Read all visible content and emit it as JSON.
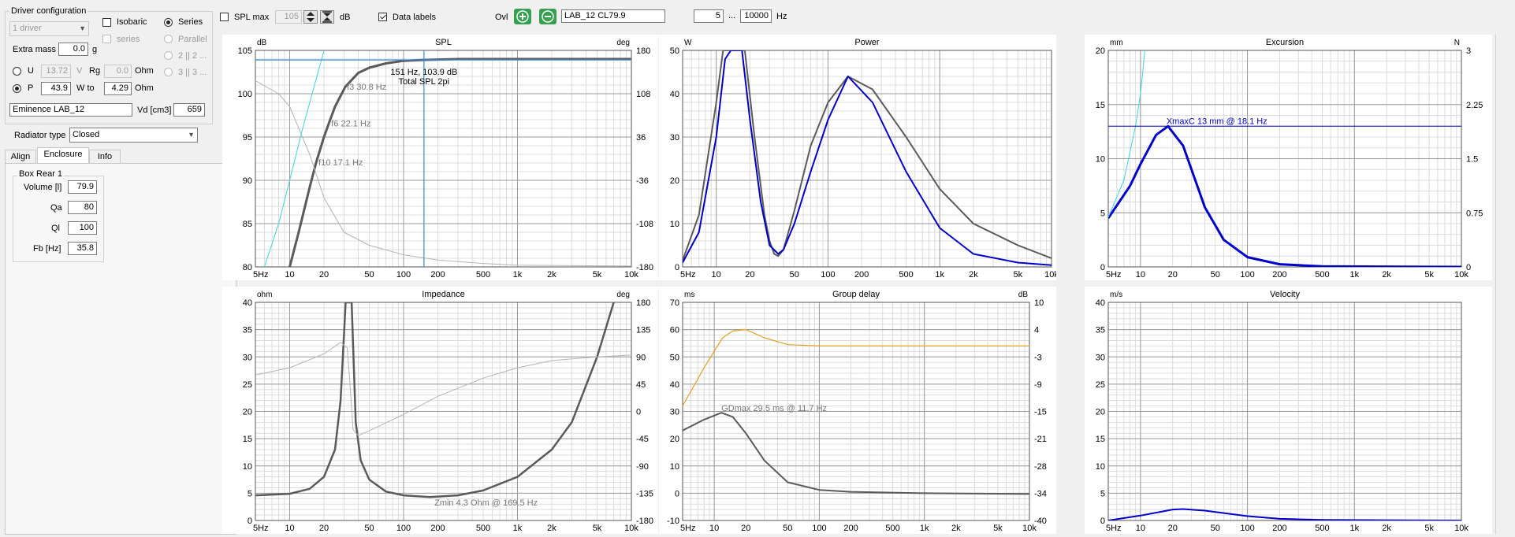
{
  "driver_config": {
    "legend": "Driver configuration",
    "drivers_select": "1 driver",
    "isobaric_label": "Isobaric",
    "series_label": "Series",
    "series_sub_label": "series",
    "parallel_label": "Parallel",
    "opt_2_label": "2 || 2 ...",
    "opt_3_label": "3 || 3 ...",
    "extra_mass_label": "Extra mass",
    "extra_mass_value": "0.0",
    "extra_mass_unit": "g",
    "u_label": "U",
    "u_value": "13.72",
    "u_unit": "V",
    "rg_label": "Rg",
    "rg_value": "0.0",
    "rg_unit": "Ohm",
    "p_label": "P",
    "p_value": "43.9",
    "w_to_label": "W to",
    "w_to_value": "4.29",
    "w_to_unit": "Ohm",
    "driver_name": "Eminence LAB_12",
    "vd_label": "Vd [cm3]",
    "vd_value": "659"
  },
  "radiator": {
    "label": "Radiator type",
    "value": "Closed"
  },
  "tabs": [
    "Align",
    "Enclosure",
    "Info"
  ],
  "box_rear": {
    "legend": "Box Rear 1",
    "fields": [
      {
        "label": "Volume [l]",
        "value": "79.9"
      },
      {
        "label": "Qa",
        "value": "80"
      },
      {
        "label": "Ql",
        "value": "100"
      },
      {
        "label": "Fb [Hz]",
        "value": "35.8"
      }
    ]
  },
  "toolbar": {
    "spl_max_label": "SPL max",
    "spl_max_value": "105",
    "db_unit": "dB",
    "data_labels": "Data labels",
    "ovl_label": "Ovl",
    "ovl_name": "LAB_12 CL79.9",
    "freq_from": "5",
    "freq_sep": "...",
    "freq_to": "10000",
    "freq_unit": "Hz"
  },
  "colors": {
    "main_curve": "#5a5a5a",
    "gray_curve": "#b4b4b4",
    "blue": "#0000cc",
    "cyan": "#38d8e0",
    "marker": "#3c8ad6",
    "orange": "#e8a020",
    "grid_major": "#9a9a9a",
    "grid_minor": "#dcdcdc",
    "ovl_button": "#34a050"
  },
  "freq_ticks": [
    "5Hz",
    "10",
    "20",
    "50",
    "100",
    "200",
    "500",
    "1k",
    "2k",
    "5k",
    "10k"
  ],
  "charts": {
    "spl": {
      "title": "SPL",
      "left_unit": "dB",
      "right_unit": "deg",
      "left_ticks": [
        "105",
        "100",
        "95",
        "90",
        "85",
        "80"
      ],
      "right_ticks": [
        "180",
        "108",
        "36",
        "-36",
        "-108",
        "-180"
      ],
      "annotations": [
        "151 Hz, 103.9 dB",
        "Total SPL 2pi",
        "f3 30.8 Hz",
        "f6 22.1 Hz",
        "f10 17.1 Hz"
      ]
    },
    "power": {
      "title": "Power",
      "left_unit": "W",
      "left_ticks": [
        "50",
        "40",
        "30",
        "20",
        "10",
        "0"
      ]
    },
    "excursion": {
      "title": "Excursion",
      "left_unit": "mm",
      "right_unit": "N",
      "left_ticks": [
        "20",
        "15",
        "10",
        "5",
        "0"
      ],
      "right_ticks": [
        "3",
        "2.25",
        "1.5",
        "0.75",
        "0"
      ],
      "annotations": [
        "XmaxC 13 mm  @ 18.1 Hz"
      ]
    },
    "impedance": {
      "title": "Impedance",
      "left_unit": "ohm",
      "right_unit": "deg",
      "left_ticks": [
        "40",
        "35",
        "30",
        "25",
        "20",
        "15",
        "10",
        "5",
        "0"
      ],
      "right_ticks": [
        "180",
        "135",
        "90",
        "45",
        "0",
        "-45",
        "-90",
        "-135",
        "-180"
      ],
      "annotations": [
        "Zmin 4.3 Ohm @ 169.5 Hz"
      ]
    },
    "group_delay": {
      "title": "Group delay",
      "left_unit": "ms",
      "right_unit": "dB",
      "left_ticks": [
        "70",
        "60",
        "50",
        "40",
        "30",
        "20",
        "10",
        "0",
        "-10"
      ],
      "right_ticks": [
        "10",
        "4",
        "-3",
        "-9",
        "-15",
        "-21",
        "-28",
        "-34",
        "-40"
      ],
      "annotations": [
        "GDmax 29.5 ms  @ 11.7 Hz"
      ]
    },
    "velocity": {
      "title": "Velocity",
      "left_unit": "m/s",
      "left_ticks": [
        "40",
        "35",
        "30",
        "25",
        "20",
        "15",
        "10",
        "5",
        "0"
      ]
    }
  },
  "chart_data": [
    {
      "type": "line",
      "title": "SPL",
      "x_scale": "log",
      "xlim": [
        5,
        10000
      ],
      "ylim": [
        80,
        105
      ],
      "y2lim": [
        -180,
        180
      ],
      "series": [
        {
          "values": [
            [
              8,
              76
            ],
            [
              10,
              80
            ],
            [
              12,
              84
            ],
            [
              15,
              89.2
            ],
            [
              17.1,
              92.1
            ],
            [
              20,
              95
            ],
            [
              22.1,
              96.6
            ],
            [
              25,
              98.5
            ],
            [
              30.8,
              100.8
            ],
            [
              40,
              102.4
            ],
            [
              50,
              103
            ],
            [
              70,
              103.5
            ],
            [
              100,
              103.8
            ],
            [
              151,
              103.9
            ],
            [
              300,
              104
            ],
            [
              1000,
              104
            ],
            [
              10000,
              104
            ]
          ]
        },
        {
          "values": [
            [
              5,
              101.5
            ],
            [
              8,
              100
            ],
            [
              10,
              98.5
            ],
            [
              15,
              93
            ],
            [
              20,
              88
            ],
            [
              30,
              84
            ],
            [
              50,
              82.5
            ],
            [
              100,
              81.4
            ],
            [
              200,
              80.8
            ],
            [
              500,
              80.4
            ],
            [
              1000,
              80.2
            ],
            [
              10000,
              80.1
            ]
          ]
        },
        {
          "values": [
            [
              6,
              80
            ],
            [
              8,
              85
            ],
            [
              10,
              90
            ],
            [
              13,
              96
            ],
            [
              20,
              105
            ]
          ]
        }
      ]
    },
    {
      "type": "line",
      "title": "Power",
      "x_scale": "log",
      "xlim": [
        5,
        10000
      ],
      "ylim": [
        0,
        50
      ],
      "series": [
        {
          "values": [
            [
              5,
              1.5
            ],
            [
              7,
              12
            ],
            [
              10,
              38
            ],
            [
              11.5,
              50
            ],
            [
              18,
              50
            ],
            [
              22,
              30
            ],
            [
              27,
              12
            ],
            [
              30,
              6
            ],
            [
              33,
              3
            ],
            [
              35.8,
              2.5
            ],
            [
              40,
              4
            ],
            [
              50,
              13
            ],
            [
              70,
              28
            ],
            [
              100,
              38
            ],
            [
              151,
              44
            ],
            [
              250,
              41
            ],
            [
              500,
              30
            ],
            [
              1000,
              18
            ],
            [
              2000,
              10
            ],
            [
              5000,
              5
            ],
            [
              10000,
              2
            ]
          ]
        },
        {
          "values": [
            [
              5,
              1
            ],
            [
              7,
              8
            ],
            [
              10,
              30
            ],
            [
              12,
              48
            ],
            [
              13.5,
              50
            ],
            [
              17,
              50
            ],
            [
              20,
              34
            ],
            [
              25,
              15
            ],
            [
              30,
              5
            ],
            [
              35.8,
              3
            ],
            [
              40,
              4
            ],
            [
              50,
              10
            ],
            [
              70,
              22
            ],
            [
              100,
              34
            ],
            [
              151,
              44
            ],
            [
              250,
              38
            ],
            [
              500,
              22
            ],
            [
              1000,
              9
            ],
            [
              2000,
              3
            ],
            [
              5000,
              1
            ],
            [
              10000,
              0.4
            ]
          ]
        }
      ]
    },
    {
      "type": "line",
      "title": "Excursion",
      "x_scale": "log",
      "xlim": [
        5,
        10000
      ],
      "ylim": [
        0,
        20
      ],
      "y2lim": [
        0,
        3
      ],
      "series": [
        {
          "values": [
            [
              5,
              4.5
            ],
            [
              8,
              7.5
            ],
            [
              10,
              9.5
            ],
            [
              14,
              12.2
            ],
            [
              18.1,
              13
            ],
            [
              25,
              11.2
            ],
            [
              40,
              5.5
            ],
            [
              60,
              2.5
            ],
            [
              100,
              0.9
            ],
            [
              200,
              0.25
            ],
            [
              500,
              0.05
            ],
            [
              10000,
              0
            ]
          ]
        },
        {
          "values": [
            [
              5,
              4.6
            ],
            [
              7,
              8
            ],
            [
              9,
              13
            ],
            [
              10,
              16
            ],
            [
              11,
              20
            ]
          ]
        },
        {
          "name": "XmaxC",
          "values": [
            [
              5,
              13
            ],
            [
              10000,
              13
            ]
          ]
        }
      ]
    },
    {
      "type": "line",
      "title": "Impedance",
      "x_scale": "log",
      "xlim": [
        5,
        10000
      ],
      "ylim": [
        0,
        40
      ],
      "y2lim": [
        -180,
        180
      ],
      "series": [
        {
          "values": [
            [
              5,
              4.6
            ],
            [
              10,
              4.9
            ],
            [
              15,
              5.8
            ],
            [
              20,
              8
            ],
            [
              25,
              13
            ],
            [
              28,
              22
            ],
            [
              31,
              40
            ],
            [
              35,
              40
            ],
            [
              38,
              18
            ],
            [
              42,
              11
            ],
            [
              50,
              7.5
            ],
            [
              70,
              5.3
            ],
            [
              100,
              4.6
            ],
            [
              169.5,
              4.3
            ],
            [
              300,
              4.6
            ],
            [
              500,
              5.5
            ],
            [
              1000,
              8
            ],
            [
              2000,
              13
            ],
            [
              3000,
              18
            ],
            [
              5000,
              30
            ],
            [
              7000,
              40
            ]
          ]
        },
        {
          "values": [
            [
              5,
              60
            ],
            [
              10,
              72
            ],
            [
              20,
              95
            ],
            [
              28,
              114
            ],
            [
              32,
              105
            ],
            [
              34,
              40
            ],
            [
              36,
              -30
            ],
            [
              40,
              -40
            ],
            [
              50,
              -32
            ],
            [
              100,
              -5
            ],
            [
              200,
              25
            ],
            [
              500,
              55
            ],
            [
              1000,
              72
            ],
            [
              2000,
              84
            ],
            [
              5000,
              90
            ],
            [
              10000,
              93
            ]
          ]
        }
      ]
    },
    {
      "type": "line",
      "title": "Group delay",
      "x_scale": "log",
      "xlim": [
        5,
        10000
      ],
      "ylim": [
        -10,
        70
      ],
      "y2lim": [
        -40,
        10
      ],
      "series": [
        {
          "values": [
            [
              5,
              23
            ],
            [
              8,
              27
            ],
            [
              11.7,
              29.5
            ],
            [
              15,
              28
            ],
            [
              20,
              22
            ],
            [
              30,
              12
            ],
            [
              50,
              4
            ],
            [
              100,
              1.2
            ],
            [
              200,
              0.5
            ],
            [
              1000,
              0
            ],
            [
              10000,
              -0.3
            ]
          ]
        },
        {
          "values": [
            [
              5,
              32
            ],
            [
              8,
              46
            ],
            [
              12,
              57
            ],
            [
              15,
              59.5
            ],
            [
              20,
              60
            ],
            [
              30,
              57
            ],
            [
              50,
              54.5
            ],
            [
              100,
              54
            ],
            [
              10000,
              54
            ]
          ]
        }
      ]
    },
    {
      "type": "line",
      "title": "Velocity",
      "x_scale": "log",
      "xlim": [
        5,
        10000
      ],
      "ylim": [
        0,
        40
      ],
      "series": [
        {
          "values": [
            [
              5,
              0
            ],
            [
              10,
              0.9
            ],
            [
              20,
              2
            ],
            [
              25,
              2.1
            ],
            [
              40,
              1.8
            ],
            [
              100,
              0.8
            ],
            [
              200,
              0.3
            ],
            [
              500,
              0.1
            ],
            [
              10000,
              0
            ]
          ]
        }
      ]
    }
  ]
}
